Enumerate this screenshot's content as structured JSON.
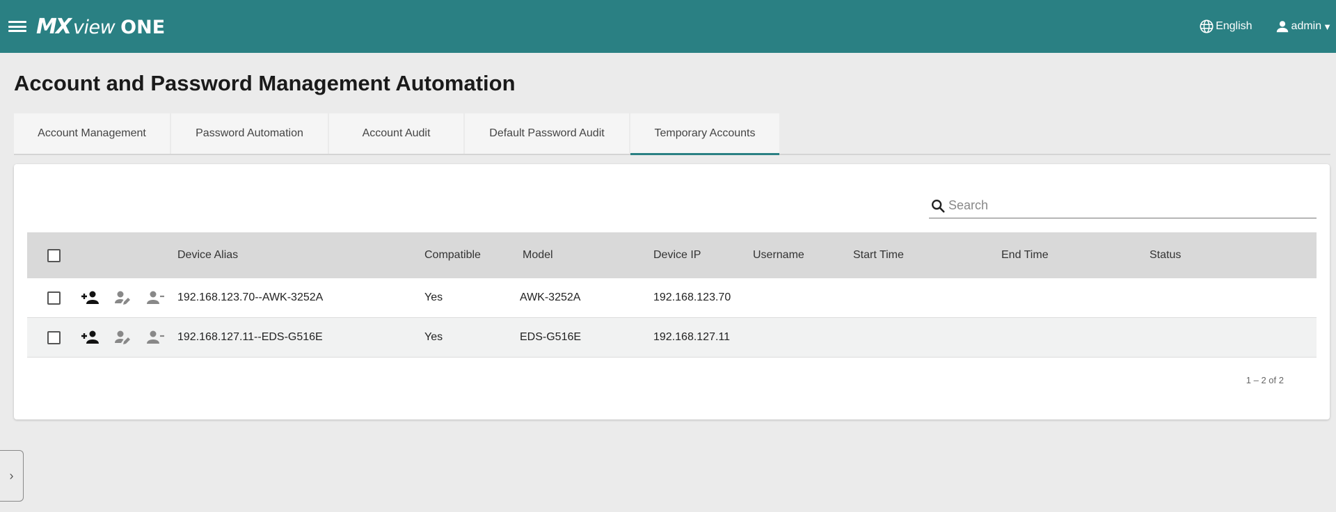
{
  "header": {
    "logo": {
      "mx": "MX",
      "view": "view",
      "one": "ONE"
    },
    "language": "English",
    "user": "admin",
    "caret": "▼",
    "brand_color": "#2a8083"
  },
  "page": {
    "title": "Account and Password Management Automation"
  },
  "tabs": [
    {
      "label": "Account Management"
    },
    {
      "label": "Password Automation"
    },
    {
      "label": "Account Audit"
    },
    {
      "label": "Default Password Audit"
    },
    {
      "label": "Temporary Accounts"
    }
  ],
  "active_tab": "Temporary Accounts",
  "search": {
    "placeholder": "Search",
    "value": ""
  },
  "table": {
    "columns": {
      "device_alias": "Device Alias",
      "compatible": "Compatible",
      "model": "Model",
      "device_ip": "Device IP",
      "username": "Username",
      "start_time": "Start Time",
      "end_time": "End Time",
      "status": "Status"
    },
    "row_action_icons": [
      "person-add-icon",
      "person-edit-icon",
      "person-remove-icon"
    ],
    "rows": [
      {
        "device_alias": "192.168.123.70--AWK-3252A",
        "compatible": "Yes",
        "model": "AWK-3252A",
        "device_ip": "192.168.123.70",
        "username": "",
        "start_time": "",
        "end_time": "",
        "status": ""
      },
      {
        "device_alias": "192.168.127.11--EDS-G516E",
        "compatible": "Yes",
        "model": "EDS-G516E",
        "device_ip": "192.168.127.11",
        "username": "",
        "start_time": "",
        "end_time": "",
        "status": ""
      }
    ]
  },
  "pagination": {
    "text": "1 – 2 of 2"
  },
  "sidebar_toggle": {
    "glyph": "›"
  }
}
